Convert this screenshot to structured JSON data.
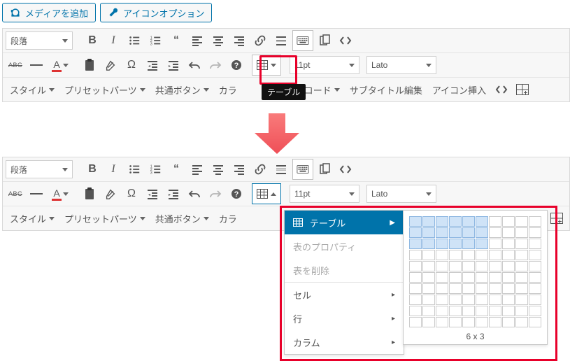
{
  "top_buttons": {
    "add_media": "メディアを追加",
    "icon_options": "アイコンオプション"
  },
  "format_label": "段落",
  "font_size": "11pt",
  "font_family": "Lato",
  "row3": {
    "style": "スタイル",
    "preset": "プリセットパーツ",
    "common_btn": "共通ボタン",
    "color_trunc": "カラ",
    "shortcode_frag": "ートコード",
    "subtitle": "サブタイトル編集",
    "icon_insert": "アイコン挿入"
  },
  "tooltip": "テーブル",
  "menu": {
    "table": "テーブル",
    "props": "表のプロパティ",
    "delete": "表を削除",
    "cell": "セル",
    "row": "行",
    "col": "カラム"
  },
  "grid": {
    "cols": 10,
    "rows": 10,
    "sel_cols": 6,
    "sel_rows": 3,
    "label": "6 x 3"
  },
  "chart_data": {
    "type": "table",
    "grid_size": [
      10,
      10
    ],
    "selection": [
      6,
      3
    ]
  }
}
